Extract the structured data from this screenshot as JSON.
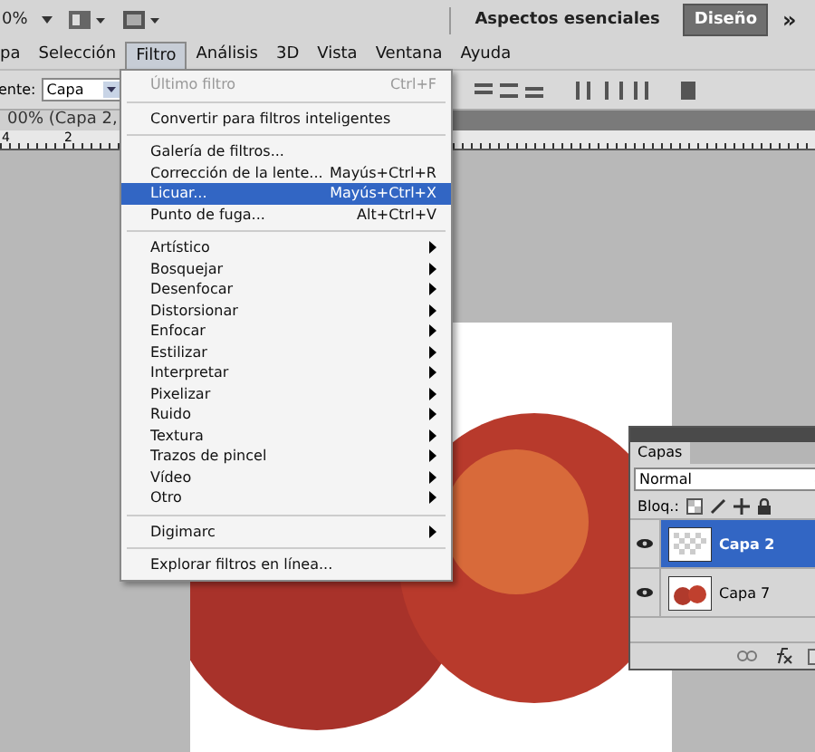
{
  "top_bar": {
    "zoom": "0%",
    "workspaces": [
      {
        "label": "Aspectos esenciales",
        "selected": false
      },
      {
        "label": "Diseño",
        "selected": true
      }
    ],
    "more": "»"
  },
  "menu_bar": [
    {
      "label": "pa",
      "selected": false
    },
    {
      "label": "Selección",
      "selected": false
    },
    {
      "label": "Filtro",
      "selected": true
    },
    {
      "label": "Análisis",
      "selected": false
    },
    {
      "label": "3D",
      "selected": false
    },
    {
      "label": "Vista",
      "selected": false
    },
    {
      "label": "Ventana",
      "selected": false
    },
    {
      "label": "Ayuda",
      "selected": false
    }
  ],
  "options_bar": {
    "label": "ente:",
    "select_value": "Capa"
  },
  "document_tab": {
    "title": "00% (Capa 2,"
  },
  "ruler": {
    "labels": [
      "4",
      "2"
    ]
  },
  "filter_menu": {
    "groups": [
      [
        {
          "label": "Último filtro",
          "shortcut": "Ctrl+F",
          "submenu": false,
          "disabled": true,
          "selected": false
        }
      ],
      [
        {
          "label": "Convertir para filtros inteligentes",
          "submenu": false,
          "disabled": false,
          "selected": false
        }
      ],
      [
        {
          "label": "Galería de filtros...",
          "submenu": false,
          "disabled": false,
          "selected": false
        },
        {
          "label": "Corrección de la lente...",
          "shortcut": "Mayús+Ctrl+R",
          "submenu": false,
          "disabled": false,
          "selected": false
        },
        {
          "label": "Licuar...",
          "shortcut": "Mayús+Ctrl+X",
          "submenu": false,
          "disabled": false,
          "selected": true
        },
        {
          "label": "Punto de fuga...",
          "shortcut": "Alt+Ctrl+V",
          "submenu": false,
          "disabled": false,
          "selected": false
        }
      ],
      [
        {
          "label": "Artístico",
          "submenu": true,
          "disabled": false,
          "selected": false
        },
        {
          "label": "Bosquejar",
          "submenu": true,
          "disabled": false,
          "selected": false
        },
        {
          "label": "Desenfocar",
          "submenu": true,
          "disabled": false,
          "selected": false
        },
        {
          "label": "Distorsionar",
          "submenu": true,
          "disabled": false,
          "selected": false
        },
        {
          "label": "Enfocar",
          "submenu": true,
          "disabled": false,
          "selected": false
        },
        {
          "label": "Estilizar",
          "submenu": true,
          "disabled": false,
          "selected": false
        },
        {
          "label": "Interpretar",
          "submenu": true,
          "disabled": false,
          "selected": false
        },
        {
          "label": "Pixelizar",
          "submenu": true,
          "disabled": false,
          "selected": false
        },
        {
          "label": "Ruido",
          "submenu": true,
          "disabled": false,
          "selected": false
        },
        {
          "label": "Textura",
          "submenu": true,
          "disabled": false,
          "selected": false
        },
        {
          "label": "Trazos de pincel",
          "submenu": true,
          "disabled": false,
          "selected": false
        },
        {
          "label": "Vídeo",
          "submenu": true,
          "disabled": false,
          "selected": false
        },
        {
          "label": "Otro",
          "submenu": true,
          "disabled": false,
          "selected": false
        }
      ],
      [
        {
          "label": "Digimarc",
          "submenu": true,
          "disabled": false,
          "selected": false
        }
      ],
      [
        {
          "label": "Explorar filtros en línea...",
          "submenu": false,
          "disabled": false,
          "selected": false
        }
      ]
    ]
  },
  "layers_panel": {
    "tab": "Capas",
    "blend_mode": "Normal",
    "lock_label": "Bloq.:",
    "layers": [
      {
        "name": "Capa 2",
        "selected": true,
        "kind": "transparent"
      },
      {
        "name": "Capa 7",
        "selected": false,
        "kind": "photo"
      }
    ]
  }
}
